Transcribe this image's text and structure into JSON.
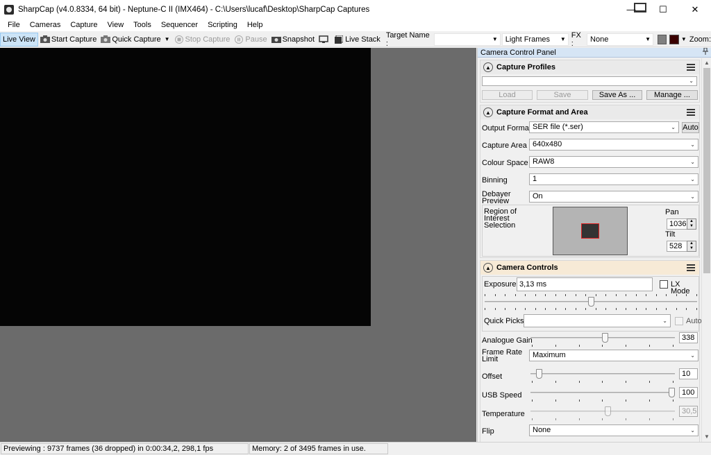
{
  "window": {
    "title": "SharpCap (v4.0.8334, 64 bit) - Neptune-C II (IMX464) - C:\\Users\\lucaf\\Desktop\\SharpCap Captures",
    "minimize": "—",
    "maximize": "☐",
    "close": "✕"
  },
  "menu": [
    "File",
    "Cameras",
    "Capture",
    "View",
    "Tools",
    "Sequencer",
    "Scripting",
    "Help"
  ],
  "toolbar": {
    "live_view": "Live View",
    "start_capture": "Start Capture",
    "quick_capture": "Quick Capture",
    "stop_capture": "Stop Capture",
    "pause": "Pause",
    "snapshot": "Snapshot",
    "live_stack": "Live Stack",
    "target_name_label": "Target Name :",
    "target_name_value": "",
    "frame_type": "Light Frames",
    "fx_label": "FX :",
    "fx_value": "None",
    "zoom_label": "Zoom:",
    "color_swatch_1": "#808080",
    "color_swatch_2": "#3a0000"
  },
  "panel": {
    "title": "Camera Control Panel",
    "pin_icon": "pin-icon",
    "capture_profiles": {
      "title": "Capture Profiles",
      "selected": "",
      "load": "Load",
      "save": "Save",
      "save_as": "Save As ...",
      "manage": "Manage ..."
    },
    "capture_format": {
      "title": "Capture Format and Area",
      "output_format_label": "Output Format",
      "output_format_value": "SER file (*.ser)",
      "auto_button": "Auto",
      "capture_area_label": "Capture Area",
      "capture_area_value": "640x480",
      "colour_space_label": "Colour Space",
      "colour_space_value": "RAW8",
      "binning_label": "Binning",
      "binning_value": "1",
      "debayer_label_1": "Debayer",
      "debayer_label_2": "Preview",
      "debayer_value": "On",
      "roi_label_1": "Region of",
      "roi_label_2": "Interest",
      "roi_label_3": "Selection",
      "pan_label": "Pan",
      "pan_value": "1036",
      "tilt_label": "Tilt",
      "tilt_value": "528"
    },
    "camera_controls": {
      "title": "Camera Controls",
      "exposure_label": "Exposure",
      "exposure_value": "3,13 ms",
      "lx_mode_label": "LX Mode",
      "exposure_slider_fraction": 0.5,
      "quick_picks_label": "Quick Picks",
      "quick_picks_value": "",
      "auto_label": "Auto",
      "analogue_gain_label": "Analogue Gain",
      "analogue_gain_value": "338",
      "analogue_gain_fraction": 0.52,
      "frame_rate_label_1": "Frame Rate",
      "frame_rate_label_2": "Limit",
      "frame_rate_value": "Maximum",
      "offset_label": "Offset",
      "offset_value": "10",
      "offset_fraction": 0.04,
      "usb_speed_label": "USB Speed",
      "usb_speed_value": "100",
      "usb_speed_fraction": 1.0,
      "temperature_label": "Temperature",
      "temperature_value": "30,5",
      "temperature_fraction": 0.54,
      "flip_label": "Flip",
      "flip_value": "None"
    }
  },
  "status": {
    "previewing": "Previewing : 9737 frames (36 dropped) in 0:00:34,2, 298,1 fps",
    "memory": "Memory: 2 of 3495 frames in use."
  }
}
